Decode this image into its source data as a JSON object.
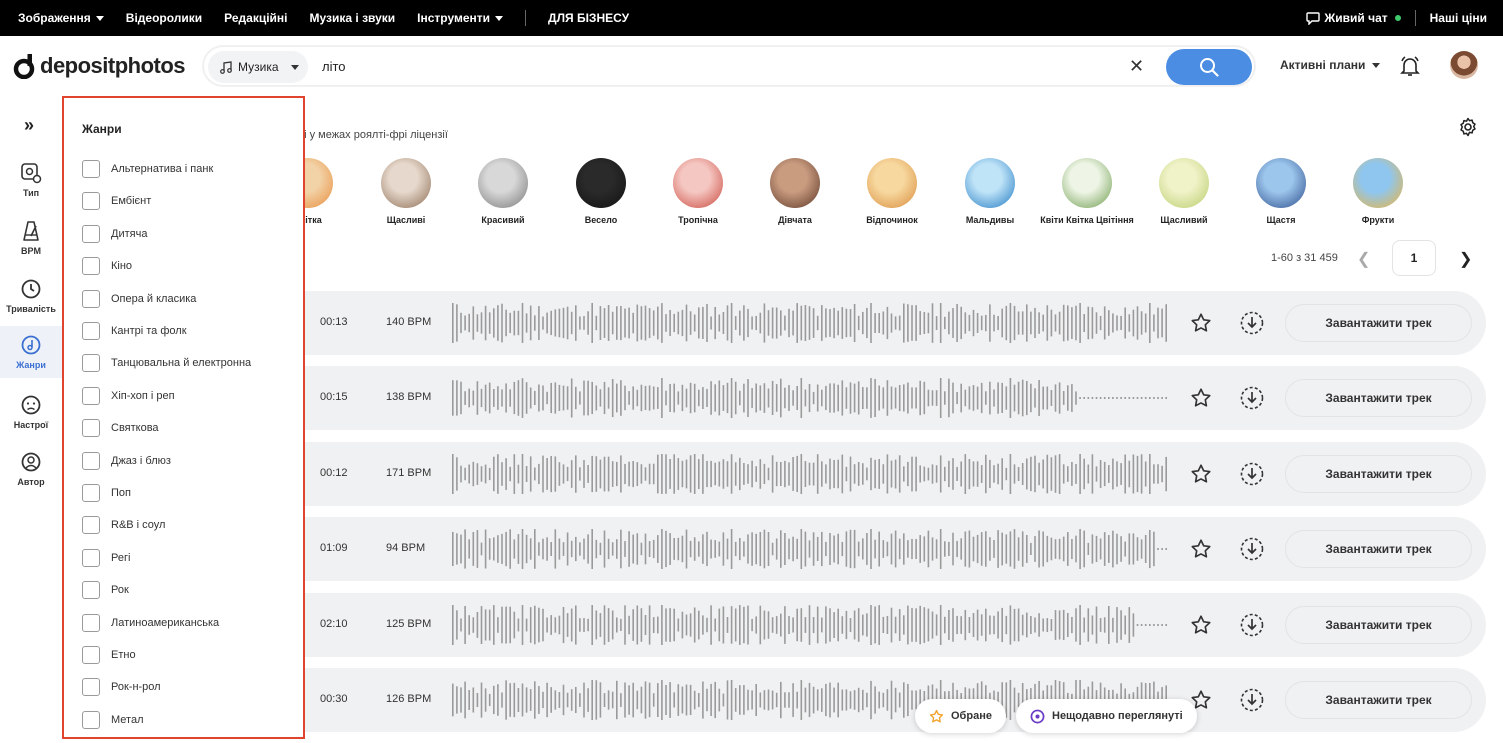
{
  "colors": {
    "accent": "#4a8de3",
    "highlight": "#e0442f",
    "active": "#3b6fd1",
    "topbar": "#000000"
  },
  "topbar": {
    "nav": [
      "Зображення",
      "Відеоролики",
      "Редакційні",
      "Музика і звуки",
      "Інструменти",
      "ДЛЯ БІЗНЕСУ"
    ],
    "live_chat": "Живий чат",
    "prices": "Наші ціни"
  },
  "header": {
    "logo": "depositphotos",
    "type_select": "Музика",
    "query": "літо",
    "plans": "Активні плани"
  },
  "sidebar": {
    "expand": "»",
    "items": [
      {
        "label": "Тип",
        "icon": "type-icon"
      },
      {
        "label": "BPM",
        "icon": "metronome-icon"
      },
      {
        "label": "Тривалість",
        "icon": "clock-icon"
      },
      {
        "label": "Жанри",
        "icon": "genre-icon",
        "active": true
      },
      {
        "label": "Настрої",
        "icon": "mood-icon"
      },
      {
        "label": "Автор",
        "icon": "author-icon"
      }
    ]
  },
  "filter": {
    "title": "Жанри",
    "genres": [
      "Альтернатива і панк",
      "Ембієнт",
      "Дитяча",
      "Кіно",
      "Опера й класика",
      "Кантрі та фолк",
      "Танцювальна й електронна",
      "Хіп-хоп і реп",
      "Святкова",
      "Джаз і блюз",
      "Поп",
      "R&B і соул",
      "Регі",
      "Рок",
      "Латиноамериканська",
      "Етно",
      "Рок-н-рол",
      "Метал"
    ]
  },
  "license_text": "ні у межах роялті-фрі ліцензії",
  "categories": [
    {
      "label": "Квітка",
      "colors": [
        "#f2d3a8",
        "#e88c3c"
      ]
    },
    {
      "label": "Щасливі",
      "colors": [
        "#e6d8cc",
        "#8a6a50"
      ]
    },
    {
      "label": "Красивий",
      "colors": [
        "#d8d8d8",
        "#777777"
      ]
    },
    {
      "label": "Весело",
      "colors": [
        "#2a2a2a",
        "#111111"
      ]
    },
    {
      "label": "Тропічна",
      "colors": [
        "#f5c7c2",
        "#c8463a"
      ]
    },
    {
      "label": "Дівчата",
      "colors": [
        "#c99c80",
        "#5a3424"
      ]
    },
    {
      "label": "Відпочинок",
      "colors": [
        "#f7d9a0",
        "#d88a3a"
      ]
    },
    {
      "label": "Мальдивы",
      "colors": [
        "#bfe3f7",
        "#1e78c2"
      ]
    },
    {
      "label": "Квіти Квітка Цвітіння",
      "colors": [
        "#eef5e6",
        "#6a9a4a"
      ]
    },
    {
      "label": "Щасливий",
      "colors": [
        "#f0f2c8",
        "#b8cc6a"
      ]
    },
    {
      "label": "Щастя",
      "colors": [
        "#9cc6ec",
        "#2a4a8a"
      ]
    },
    {
      "label": "Фрукти",
      "colors": [
        "#8ec6f0",
        "#f0b43a"
      ]
    }
  ],
  "pager": {
    "range": "1-60 з 31 459",
    "page": "1"
  },
  "tracks": [
    {
      "duration": "00:13",
      "bpm": "140 BPM",
      "button": "Завантажити трек"
    },
    {
      "duration": "00:15",
      "bpm": "138 BPM",
      "button": "Завантажити трек"
    },
    {
      "duration": "00:12",
      "bpm": "171 BPM",
      "button": "Завантажити трек"
    },
    {
      "duration": "01:09",
      "bpm": "94 BPM",
      "button": "Завантажити трек"
    },
    {
      "duration": "02:10",
      "bpm": "125 BPM",
      "button": "Завантажити трек"
    },
    {
      "duration": "00:30",
      "bpm": "126 BPM",
      "button": "Завантажити трек"
    }
  ],
  "floating": {
    "favorites": "Обране",
    "recent": "Нещодавно переглянуті"
  }
}
